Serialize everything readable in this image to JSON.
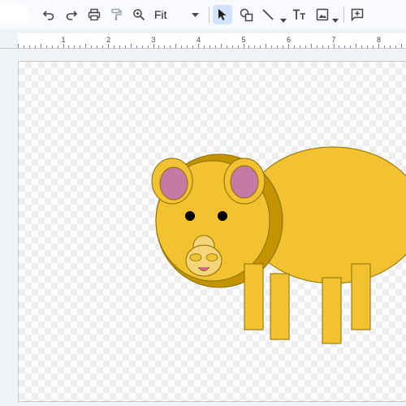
{
  "toolbar": {
    "zoom_value": "Fit",
    "icons": [
      "undo-icon",
      "redo-icon",
      "print-icon",
      "paint-format-icon",
      "zoom-icon",
      "select-arrow-icon",
      "shape-icon",
      "line-icon",
      "text-box-icon",
      "image-icon",
      "add-comment-icon"
    ],
    "active_tool": "select-arrow-icon"
  },
  "ruler": {
    "labels": [
      "1",
      "2",
      "3",
      "4",
      "5",
      "6",
      "7",
      "8"
    ]
  },
  "drawing": {
    "subject": "pig",
    "colors": {
      "body": "#f2c230",
      "outline": "#8a6d00",
      "head_shadow": "#c49400",
      "ear_inner": "#c47aa5",
      "snout": "#f5d57a",
      "eye": "#000000"
    }
  },
  "colors": {
    "toolbar_bg": "#f8fafd",
    "app_bg": "#f0f3f8",
    "active_tool_bg": "#d3e3fd"
  }
}
